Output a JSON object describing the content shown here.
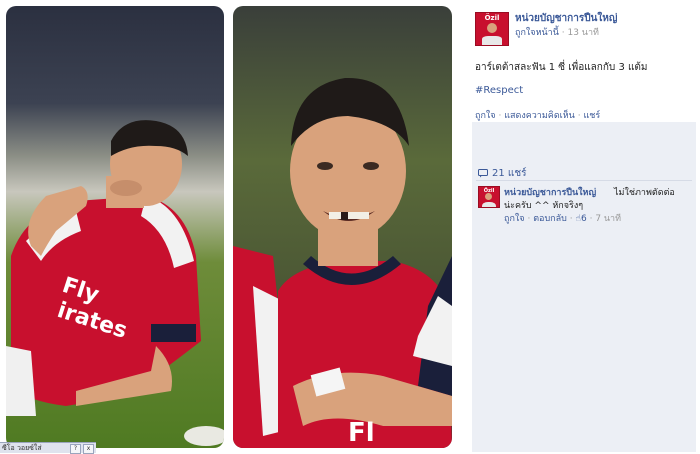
{
  "photos": {
    "left_alt": "Player in red kit blowing a kiss on the pitch",
    "right_alt": "Player in red kit smiling with a missing front tooth"
  },
  "post": {
    "page_name": "หน่วยบัญชาการปืนใหญ่",
    "avatar_label": "Özil",
    "page_link": "ถูกใจหน้านี้",
    "separator": "·",
    "time": "13 นาที",
    "text": "อาร์เตต้าสละฟัน 1 ซี่ เพื่อแลกกับ 3 แต้ม",
    "hashtag": "#Respect",
    "actions": {
      "like": "ถูกใจ",
      "comment": "แสดงความคิดเห็น",
      "share": "แชร์"
    }
  },
  "feedback": {
    "shares": "21 แชร์",
    "comment": {
      "author": "หน่วยบัญชาการปืนใหญ่",
      "avatar_label": "Özil",
      "text_line1": "ไม่ใช่ภาพตัดต่อ",
      "text_line2": "น่ะครับ ^^ หักจริงๆ",
      "like": "ถูกใจ",
      "reply": "ตอบกลับ",
      "likes_count": "6",
      "time": "7 นาที"
    }
  },
  "bottom_widget": {
    "label": "ซีโอ วอยซ์ใส่",
    "btn_help": "?",
    "btn_close": "x"
  },
  "colors": {
    "link": "#3b5998",
    "arsenal_red": "#c8102e",
    "feedback_bg": "#eceff5"
  }
}
